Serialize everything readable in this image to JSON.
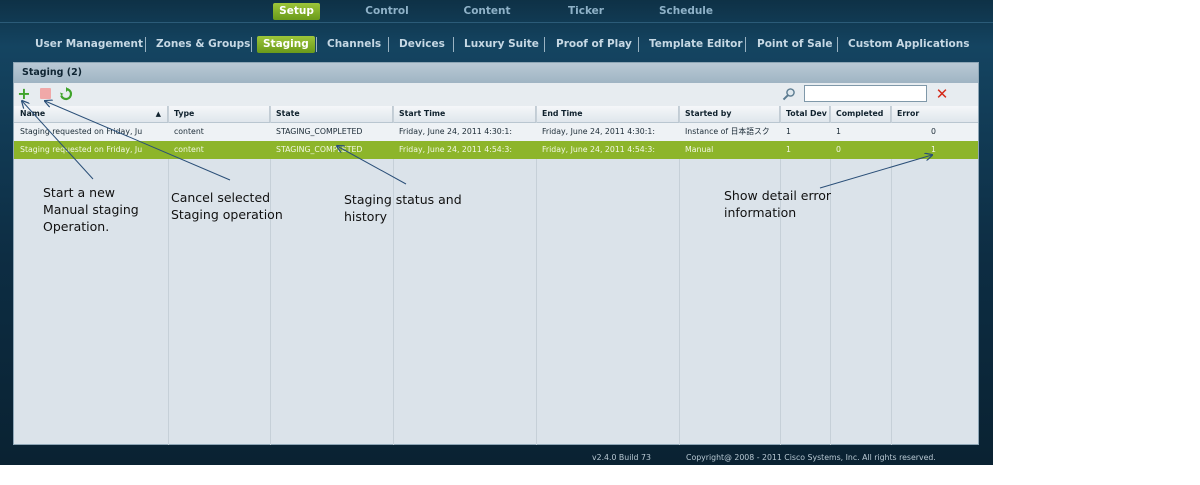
{
  "top_nav": {
    "items": [
      {
        "label": "Setup",
        "active": true
      },
      {
        "label": "Control"
      },
      {
        "label": "Content"
      },
      {
        "label": "Ticker"
      },
      {
        "label": "Schedule"
      }
    ]
  },
  "sub_nav": {
    "items": [
      {
        "label": "User Management"
      },
      {
        "label": "Zones & Groups"
      },
      {
        "label": "Staging",
        "active": true
      },
      {
        "label": "Channels"
      },
      {
        "label": "Devices"
      },
      {
        "label": "Luxury Suite"
      },
      {
        "label": "Proof of Play"
      },
      {
        "label": "Template Editor"
      },
      {
        "label": "Point of Sale"
      },
      {
        "label": "Custom Applications"
      }
    ]
  },
  "panel": {
    "title": "Staging (2)",
    "toolbar": {
      "add_icon": "plus-icon",
      "cancel_icon": "stop-icon",
      "refresh_icon": "refresh-icon",
      "search_icon": "magnifier-icon",
      "clear_icon": "close-icon",
      "search_value": ""
    }
  },
  "table": {
    "columns": [
      "Name",
      "Type",
      "State",
      "Start Time",
      "End Time",
      "Started by",
      "Total Dev",
      "Completed",
      "Error"
    ],
    "sort_indicator": "▲",
    "rows": [
      {
        "name": "Staging requested on  Friday, Ju",
        "type": "content",
        "state": "STAGING_COMPLETED",
        "start": "Friday, June 24, 2011 4:30:1:",
        "end": "Friday, June 24, 2011 4:30:1:",
        "started_by": "Instance of 日本語スク",
        "total": "1",
        "completed": "1",
        "error": "0"
      },
      {
        "name": "Staging requested on  Friday, Ju",
        "type": "content",
        "state": "STAGING_COMPLETED",
        "start": "Friday, June 24, 2011 4:54:3:",
        "end": "Friday, June 24, 2011 4:54:3:",
        "started_by": "Manual",
        "total": "1",
        "completed": "0",
        "error": "1"
      }
    ]
  },
  "footer": {
    "build": "v2.4.0 Build 73",
    "copyright": "Copyright@ 2008 - 2011 Cisco Systems, Inc. All rights reserved."
  },
  "annotations": {
    "start_new": [
      "Start a new",
      "Manual staging",
      "Operation."
    ],
    "cancel_selected": [
      "Cancel selected",
      "Staging operation"
    ],
    "staging_status": [
      "Staging status and",
      "history"
    ],
    "show_error": [
      "Show detail error",
      "information"
    ]
  },
  "colors": {
    "accent_green": "#8db52a",
    "background_dark": "#0e3146",
    "add_icon": "#3fa32a",
    "cancel_icon": "#f0a8a8",
    "clear_icon": "#d42a1a"
  }
}
